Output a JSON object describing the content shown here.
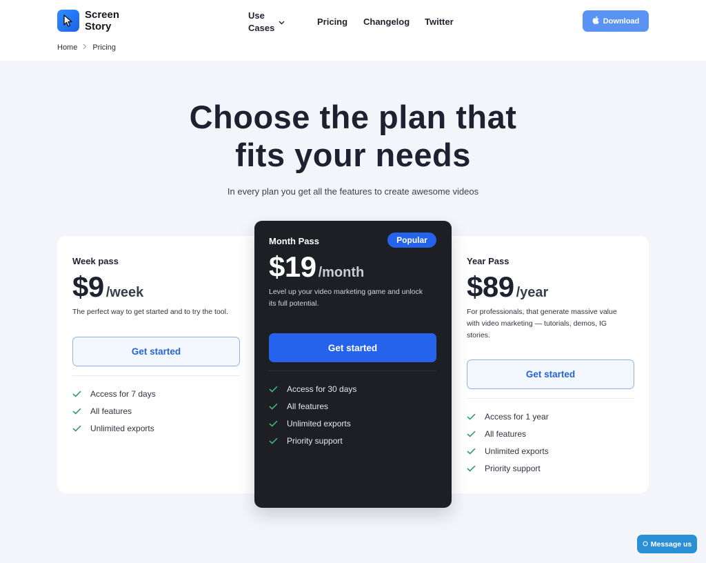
{
  "brand": {
    "line1": "Screen",
    "line2": "Story"
  },
  "nav": [
    {
      "label": "Use Cases"
    },
    {
      "label": "Pricing"
    },
    {
      "label": "Changelog"
    },
    {
      "label": "Twitter"
    }
  ],
  "download_label": "Download",
  "breadcrumb": {
    "home": "Home",
    "current": "Pricing"
  },
  "hero": {
    "title_line1": "Choose the plan that",
    "title_line2": "fits your needs",
    "subtitle": "In every plan you get all the features to create awesome videos"
  },
  "plans": [
    {
      "name": "Week pass",
      "price": "$9",
      "period": "/week",
      "desc": "The perfect way to get started and to try the tool.",
      "cta": "Get started",
      "features": [
        "Access for 7 days",
        "All features",
        "Unlimited exports"
      ]
    },
    {
      "name": "Month Pass",
      "badge": "Popular",
      "price": "$19",
      "period": "/month",
      "desc_line1": "Level up your video marketing game and unlock",
      "desc_line2": "its full potential.",
      "cta": "Get started",
      "features": [
        "Access for 30 days",
        "All features",
        "Unlimited exports",
        "Priority support"
      ]
    },
    {
      "name": "Year Pass",
      "price": "$89",
      "period": "/year",
      "desc_line1": "For professionals, that generate massive value",
      "desc_line2": "with video marketing — tutorials, demos, IG",
      "desc_line3": "stories.",
      "cta": "Get started",
      "features": [
        "Access for 1 year",
        "All features",
        "Unlimited exports",
        "Priority support"
      ]
    }
  ],
  "message_label": "Message us",
  "colors": {
    "accent": "#2563eb",
    "dark_card": "#1e1f24",
    "check": "#2f9e63",
    "download": "#5b93f5"
  }
}
